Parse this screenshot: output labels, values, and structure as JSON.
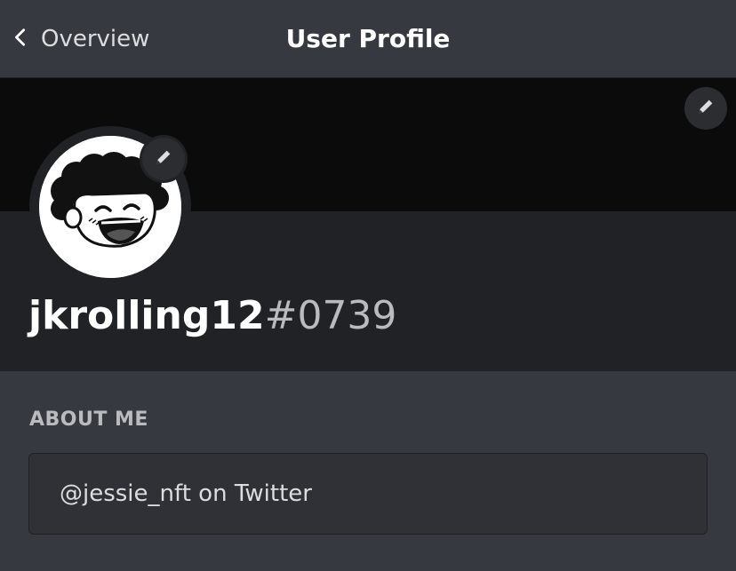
{
  "header": {
    "back_label": "Overview",
    "title": "User Profile"
  },
  "profile": {
    "username": "jkrolling12",
    "discriminator": "#0739"
  },
  "about": {
    "heading": "ABOUT ME",
    "text": "@jessie_nft on Twitter"
  },
  "icons": {
    "back": "chevron-left-icon",
    "banner_edit": "pencil-icon",
    "avatar_edit": "pencil-icon"
  },
  "colors": {
    "background": "#36393f",
    "panel": "#202225",
    "banner": "#0b0b0c",
    "input": "#2f3136",
    "text_primary": "#ffffff",
    "text_muted": "#b9bbbe"
  }
}
